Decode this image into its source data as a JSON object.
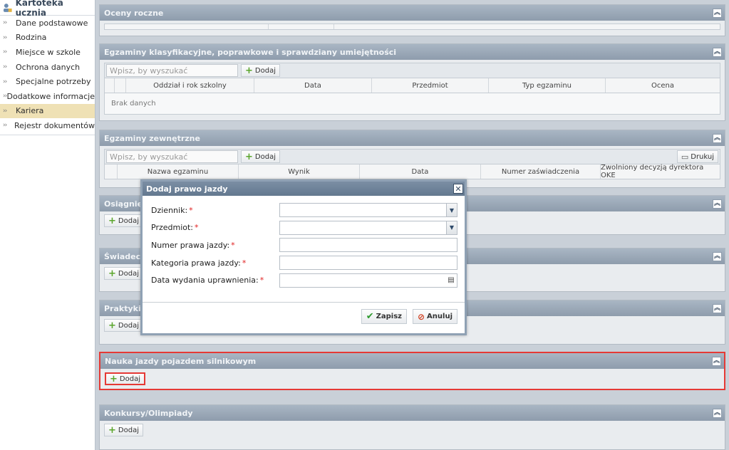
{
  "sidebar": {
    "title": "Kartoteka ucznia",
    "items": [
      {
        "label": "Dane podstawowe"
      },
      {
        "label": "Rodzina"
      },
      {
        "label": "Miejsce w szkole"
      },
      {
        "label": "Ochrona danych"
      },
      {
        "label": "Specjalne potrzeby"
      },
      {
        "label": "Dodatkowe informacje"
      },
      {
        "label": "Kariera"
      },
      {
        "label": "Rejestr dokumentów"
      }
    ]
  },
  "panels": {
    "oceny": {
      "title": "Oceny roczne"
    },
    "egzaminy_klas": {
      "title": "Egzaminy klasyfikacyjne, poprawkowe i sprawdziany umiejętności",
      "search_placeholder": "Wpisz, by wyszukać",
      "add_label": "Dodaj",
      "columns": [
        "Oddział i rok szkolny",
        "Data",
        "Przedmiot",
        "Typ egzaminu",
        "Ocena"
      ],
      "empty_text": "Brak danych"
    },
    "egzaminy_zew": {
      "title": "Egzaminy zewnętrzne",
      "search_placeholder": "Wpisz, by wyszukać",
      "add_label": "Dodaj",
      "print_label": "Drukuj",
      "columns": [
        "Nazwa egzaminu",
        "Wynik",
        "Data",
        "Numer zaświadczenia",
        "Zwolniony decyzją dyrektora OKE"
      ]
    },
    "osiagniecia": {
      "title": "Osiągnięci",
      "add_label": "Dodaj"
    },
    "swiadectwa": {
      "title": "Świadectw",
      "add_label": "Dodaj"
    },
    "praktyki": {
      "title": "Praktyki z",
      "add_label": "Dodaj"
    },
    "nauka_jazdy": {
      "title": "Nauka jazdy pojazdem silnikowym",
      "add_label": "Dodaj"
    },
    "konkursy": {
      "title": "Konkursy/Olimpiady",
      "add_label": "Dodaj"
    }
  },
  "modal": {
    "title": "Dodaj prawo jazdy",
    "fields": [
      {
        "label": "Dziennik:",
        "type": "select",
        "value": ""
      },
      {
        "label": "Przedmiot:",
        "type": "select",
        "value": ""
      },
      {
        "label": "Numer prawa jazdy:",
        "type": "text",
        "value": ""
      },
      {
        "label": "Kategoria prawa jazdy:",
        "type": "text",
        "value": ""
      },
      {
        "label": "Data wydania uprawnienia:",
        "type": "date",
        "value": ""
      }
    ],
    "required_mark": "*",
    "save_label": "Zapisz",
    "cancel_label": "Anuluj"
  },
  "colors": {
    "panel_header": "#8e9cac",
    "active_item": "#efe1b5",
    "highlight": "#e53935",
    "required": "#e02020"
  }
}
